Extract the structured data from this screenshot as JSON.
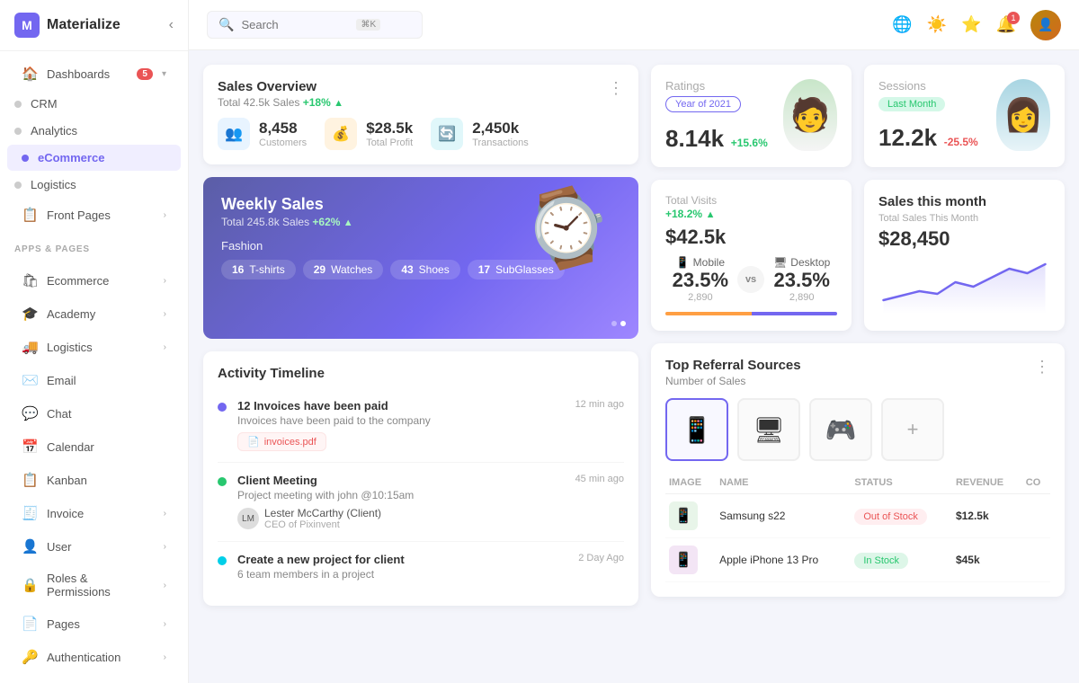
{
  "sidebar": {
    "logo": "M",
    "app_name": "Materialize",
    "dashboards_label": "Dashboards",
    "dashboards_badge": "5",
    "nav_items": [
      {
        "id": "crm",
        "label": "CRM",
        "type": "dot"
      },
      {
        "id": "analytics",
        "label": "Analytics",
        "type": "dot"
      },
      {
        "id": "ecommerce",
        "label": "eCommerce",
        "type": "dot",
        "active": true
      }
    ],
    "logistics_1": "Logistics",
    "front_pages": "Front Pages",
    "apps_pages_label": "APPS & PAGES",
    "apps": [
      {
        "id": "ecommerce",
        "label": "Ecommerce",
        "icon": "🛍",
        "has_arrow": true
      },
      {
        "id": "academy",
        "label": "Academy",
        "icon": "🎓",
        "has_arrow": true
      },
      {
        "id": "logistics",
        "label": "Logistics",
        "icon": "🚚",
        "has_arrow": true
      },
      {
        "id": "email",
        "label": "Email",
        "icon": "✉️",
        "has_arrow": false
      },
      {
        "id": "chat",
        "label": "Chat",
        "icon": "💬",
        "has_arrow": false
      },
      {
        "id": "calendar",
        "label": "Calendar",
        "icon": "📅",
        "has_arrow": false
      },
      {
        "id": "kanban",
        "label": "Kanban",
        "icon": "📋",
        "has_arrow": false
      },
      {
        "id": "invoice",
        "label": "Invoice",
        "icon": "🧾",
        "has_arrow": true
      },
      {
        "id": "user",
        "label": "User",
        "icon": "👤",
        "has_arrow": true
      },
      {
        "id": "roles",
        "label": "Roles & Permissions",
        "icon": "🔒",
        "has_arrow": true
      },
      {
        "id": "pages",
        "label": "Pages",
        "icon": "📄",
        "has_arrow": true
      },
      {
        "id": "authentication",
        "label": "Authentication",
        "icon": "🔑",
        "has_arrow": true
      }
    ]
  },
  "topbar": {
    "search_placeholder": "Search",
    "search_shortcut": "⌘K",
    "icons": [
      "translate",
      "settings",
      "star",
      "notifications",
      "avatar"
    ]
  },
  "sales_overview": {
    "title": "Sales Overview",
    "subtitle": "Total 42.5k Sales",
    "growth": "+18%",
    "customers_val": "8,458",
    "customers_label": "Customers",
    "profit_val": "$28.5k",
    "profit_label": "Total Profit",
    "transactions_val": "2,450k",
    "transactions_label": "Transactions"
  },
  "weekly_sales": {
    "title": "Weekly Sales",
    "subtitle": "Total 245.8k Sales",
    "growth": "+62%",
    "category": "Fashion",
    "tags": [
      {
        "num": "16",
        "label": "T-shirts"
      },
      {
        "num": "29",
        "label": "Watches"
      },
      {
        "num": "43",
        "label": "Shoes"
      },
      {
        "num": "17",
        "label": "SubGlasses"
      }
    ]
  },
  "ratings": {
    "title": "Ratings",
    "period_label": "Year of 2021",
    "value": "8.14k",
    "growth": "+15.6%"
  },
  "sessions": {
    "title": "Sessions",
    "period_label": "Last Month",
    "value": "12.2k",
    "change": "-25.5%"
  },
  "total_visits": {
    "title": "Total Visits",
    "growth": "+18.2%",
    "value": "$42.5k",
    "mobile_label": "Mobile",
    "desktop_label": "Desktop",
    "mobile_pct": "23.5%",
    "desktop_pct": "23.5%",
    "mobile_count": "2,890",
    "desktop_count": "2,890"
  },
  "sales_this_month": {
    "title": "Sales this month",
    "subtitle": "Total Sales This Month",
    "amount": "$28,450"
  },
  "activity_timeline": {
    "title": "Activity Timeline",
    "items": [
      {
        "color": "blue",
        "title": "12 Invoices have been paid",
        "desc": "Invoices have been paid to the company",
        "time": "12 min ago",
        "attachment": "invoices.pdf"
      },
      {
        "color": "green",
        "title": "Client Meeting",
        "desc": "Project meeting with john @10:15am",
        "time": "45 min ago",
        "author_name": "Lester McCarthy (Client)",
        "author_role": "CEO of Pixinvent"
      },
      {
        "color": "cyan",
        "title": "Create a new project for client",
        "desc": "6 team members in a project",
        "time": "2 Day Ago"
      }
    ]
  },
  "top_referral": {
    "title": "Top Referral Sources",
    "subtitle": "Number of Sales",
    "columns": [
      "IMAGE",
      "NAME",
      "STATUS",
      "REVENUE",
      "CO"
    ],
    "products": [
      {
        "icon": "📱",
        "name": "Samsung s22",
        "status": "Out of Stock",
        "status_type": "out",
        "revenue": "$12.5k"
      },
      {
        "icon": "📱",
        "name": "Apple iPhone 13 Pro",
        "status": "In Stock",
        "status_type": "in",
        "revenue": "$45k"
      }
    ]
  }
}
